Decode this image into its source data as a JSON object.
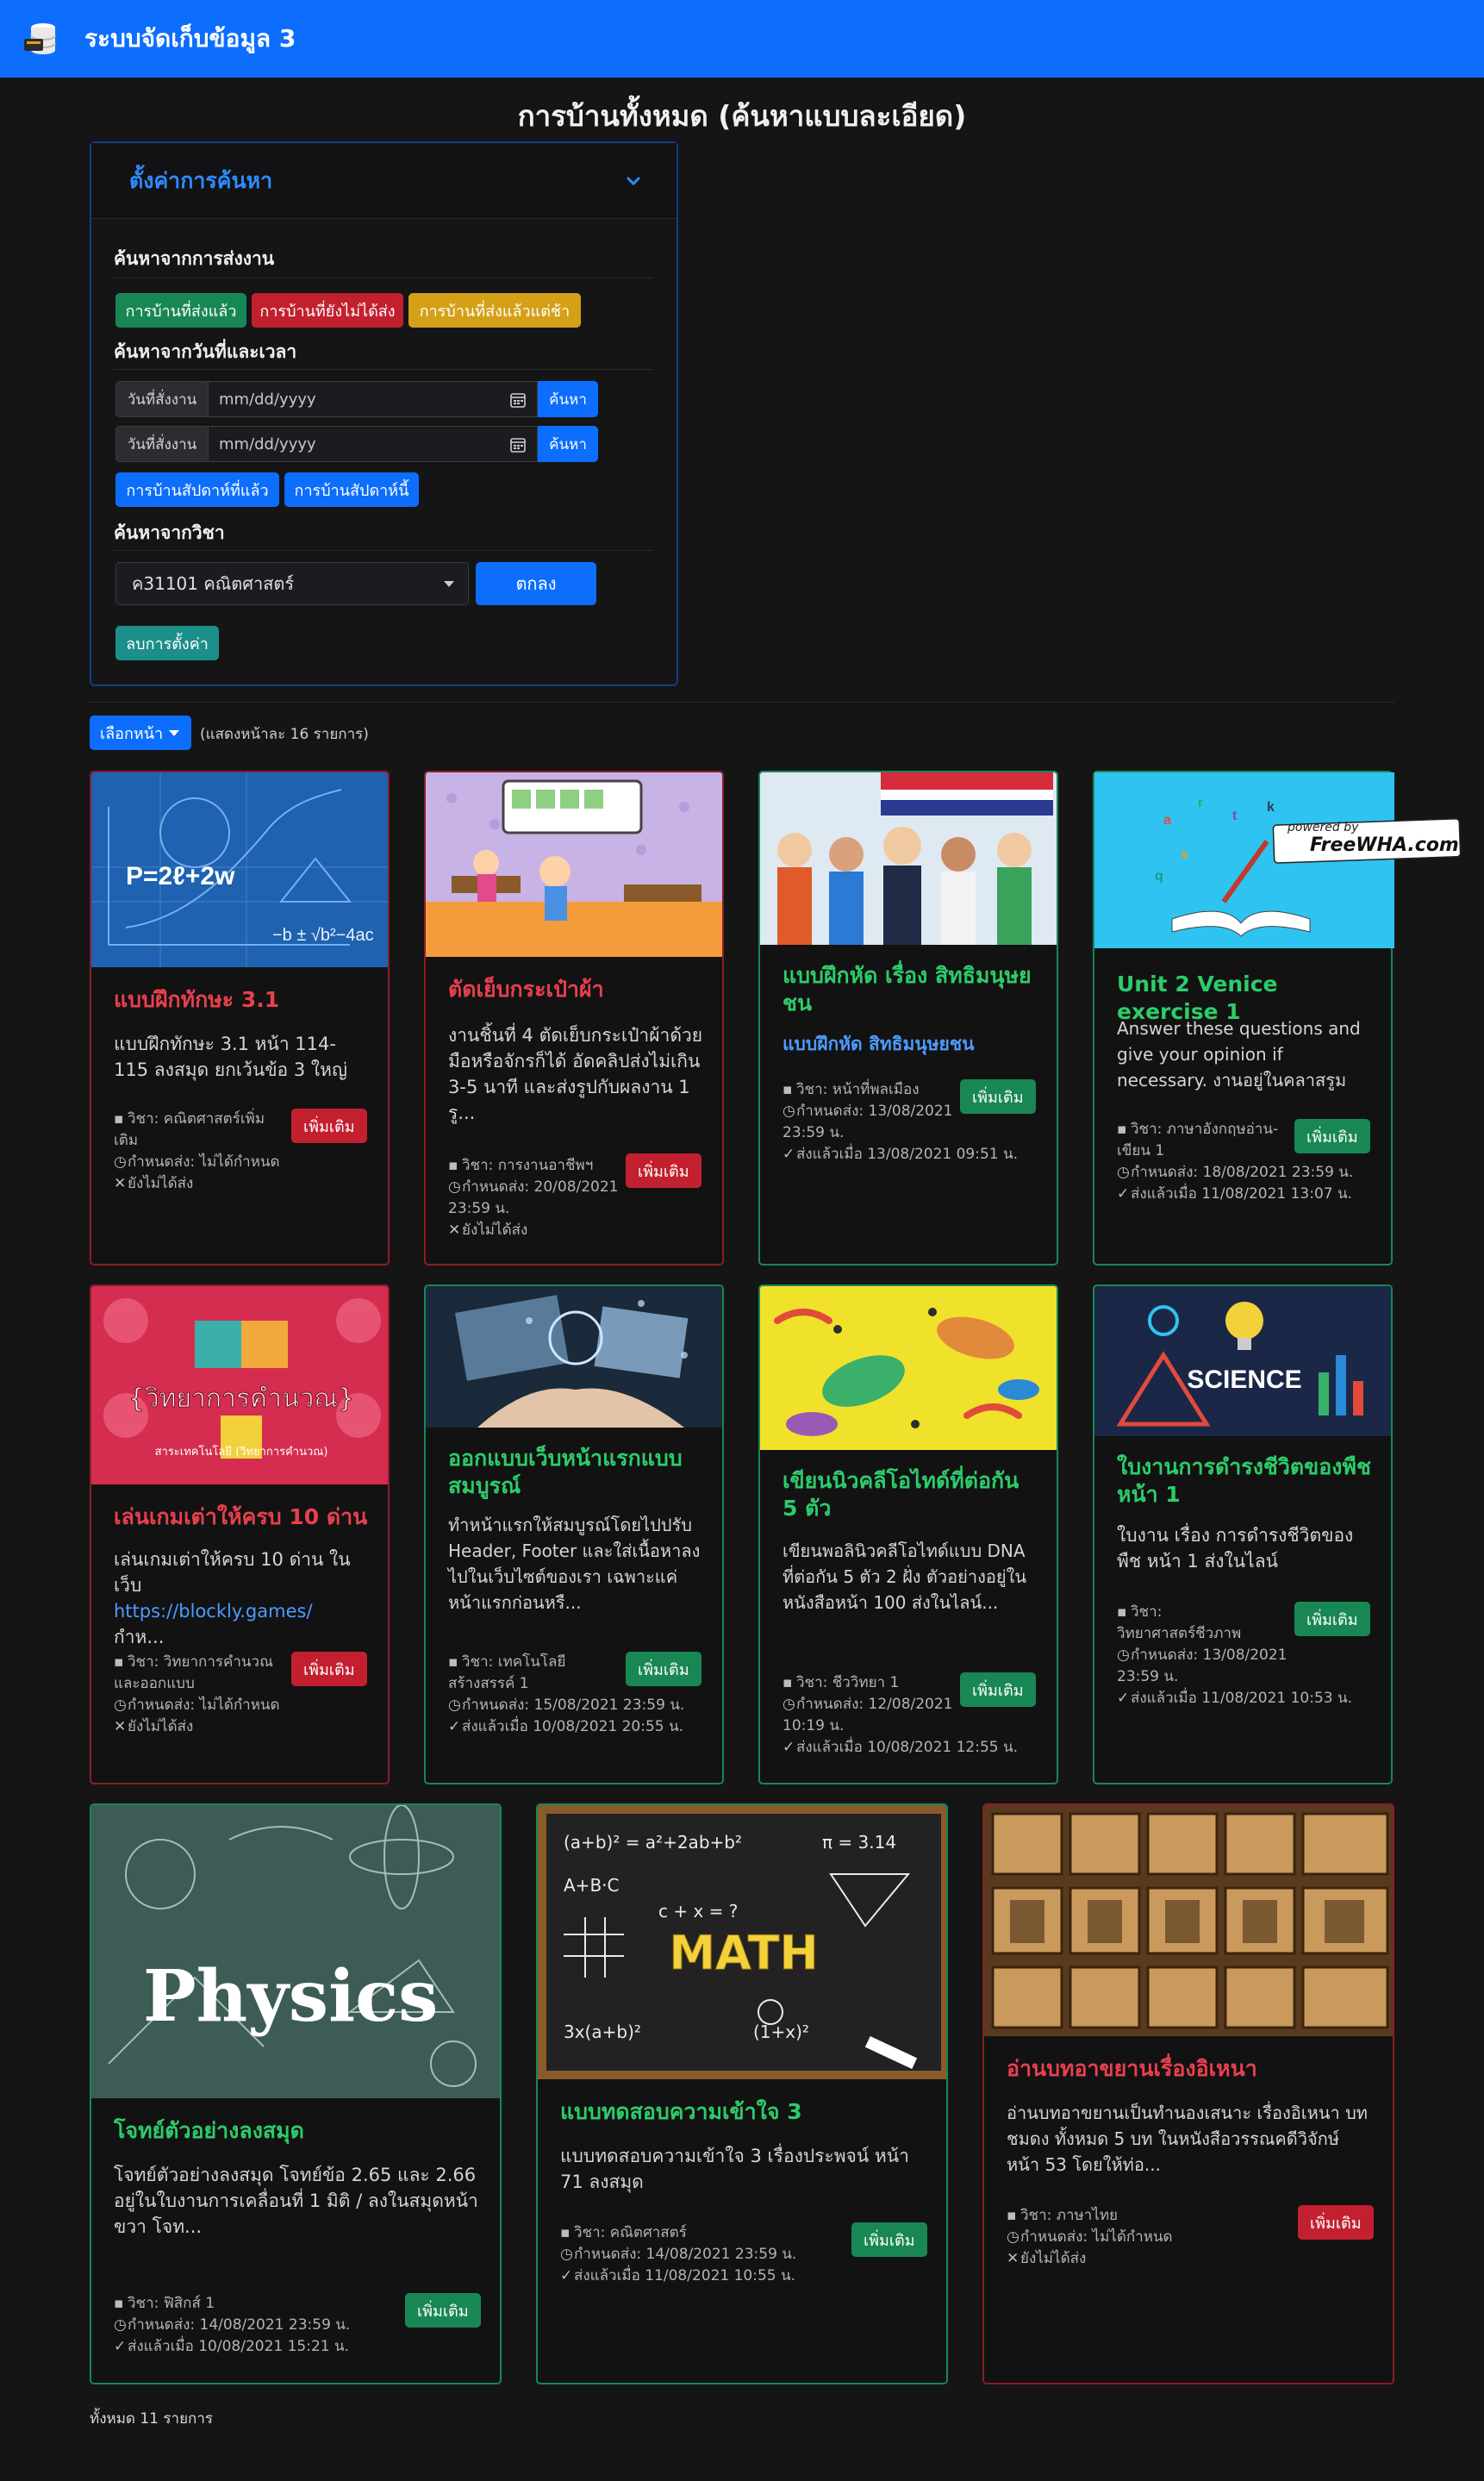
{
  "app": {
    "title": "ระบบจัดเก็บข้อมูล 3"
  },
  "page": {
    "title": "การบ้านทั้งหมด (ค้นหาแบบละเอียด)"
  },
  "search": {
    "header": "ตั้งค่าการค้นหา",
    "by_submission": "ค้นหาจากการส่งงาน",
    "btn_submitted": "การบ้านที่ส่งแล้ว",
    "btn_not_submitted": "การบ้านที่ยังไม่ได้ส่ง",
    "btn_late": "การบ้านที่ส่งแล้วแต่ช้า",
    "by_date": "ค้นหาจากวันที่และเวลา",
    "date_label_1": "วันที่สั่งงาน",
    "date_label_2": "วันที่สั่งงาน",
    "date_placeholder": "mm/dd/yyyy",
    "search_btn": "ค้นหา",
    "btn_last_week": "การบ้านสัปดาห์ที่แล้ว",
    "btn_this_week": "การบ้านสัปดาห์นี้",
    "by_subject": "ค้นหาจากวิชา",
    "subject_selected": "ค31101 คณิตศาสตร์",
    "ok_btn": "ตกลง",
    "clear_btn": "ลบการตั้งค่า"
  },
  "paging": {
    "select_label": "เลือกหน้า",
    "per_page": "(แสดงหน้าละ 16 รายการ)"
  },
  "cards": [
    {
      "title": "แบบฝึกทักษะ 3.1",
      "desc": "แบบฝึกทักษะ 3.1 หน้า 114-115 ลงสมุด ยกเว้นข้อ 3 ใหญ่",
      "subject": "วิชา: คณิตศาสตร์เพิ่มเติม",
      "due": "กำหนดส่ง: ไม่ได้กำหนด",
      "status": "ยังไม่ได้ส่ง",
      "more": "เพิ่มเติม"
    },
    {
      "title": "ตัดเย็บกระเป๋าผ้า",
      "desc": "งานชิ้นที่ 4 ตัดเย็บกระเป๋าผ้าด้วยมือหรือจักรก็ได้ อัดคลิปส่งไม่เกิน 3-5 นาที และส่งรูปกับผลงาน 1 รู...",
      "subject": "วิชา: การงานอาชีพฯ",
      "due": "กำหนดส่ง: 20/08/2021 23:59 น.",
      "status": "ยังไม่ได้ส่ง",
      "more": "เพิ่มเติม"
    },
    {
      "title": "แบบฝึกหัด เรื่อง สิทธิมนุษยชน",
      "desc": "แบบฝึกหัด สิทธิมนุษยชน",
      "subject": "วิชา: หน้าที่พลเมือง",
      "due": "กำหนดส่ง: 13/08/2021 23:59 น.",
      "status": "ส่งแล้วเมื่อ 13/08/2021 09:51 น.",
      "more": "เพิ่มเติม"
    },
    {
      "title": "Unit 2 Venice exercise 1",
      "desc": "Answer these questions and give your opinion if necessary. งานอยู่ในคลาสรูม",
      "subject": "วิชา: ภาษาอังกฤษอ่าน-เขียน 1",
      "due": "กำหนดส่ง: 18/08/2021 23:59 น.",
      "status": "ส่งแล้วเมื่อ 11/08/2021 13:07 น.",
      "more": "เพิ่มเติม",
      "image_text": "FreeWHA.com",
      "image_caption": "powered by"
    },
    {
      "title": "เล่นเกมเต่าให้ครบ 10 ด่าน",
      "desc": "เล่นเกมเต่าให้ครบ 10 ด่าน ในเว็บ",
      "link": "https://blockly.games/",
      "desc2": "กำห...",
      "subject": "วิชา: วิทยาการคำนวณและออกแบบ",
      "due": "กำหนดส่ง: ไม่ได้กำหนด",
      "status": "ยังไม่ได้ส่ง",
      "more": "เพิ่มเติม",
      "image_text": "{วิทยาการคำนวณ}",
      "image_caption": "สาระเทคโนโลยี (วิทยาการคำนวณ)"
    },
    {
      "title": "ออกแบบเว็บหน้าแรกแบบสมบูรณ์",
      "desc": "ทำหน้าแรกให้สมบูรณ์โดยไปปรับ Header, Footer และใส่เนื้อหาลงไปในเว็บไซต์ของเรา เฉพาะแค่หน้าแรกก่อนหรื...",
      "subject": "วิชา: เทคโนโลยีสร้างสรรค์ 1",
      "due": "กำหนดส่ง: 15/08/2021 23:59 น.",
      "status": "ส่งแล้วเมื่อ 10/08/2021 20:55 น.",
      "more": "เพิ่มเติม"
    },
    {
      "title": "เขียนนิวคลีโอไทด์ที่ต่อกัน 5 ตัว",
      "desc": "เขียนพอลินิวคลีโอไทด์แบบ DNA ที่ต่อกัน 5 ตัว 2 ฝั่ง ตัวอย่างอยู่ในหนังสือหน้า 100 ส่งในไลน์...",
      "subject": "วิชา: ชีววิทยา 1",
      "due": "กำหนดส่ง: 12/08/2021 10:19 น.",
      "status": "ส่งแล้วเมื่อ 10/08/2021 12:55 น.",
      "more": "เพิ่มเติม"
    },
    {
      "title": "ใบงานการดำรงชีวิตของพืช หน้า 1",
      "desc": "ใบงาน เรื่อง การดำรงชีวิตของพืช หน้า 1 ส่งในไลน์",
      "subject": "วิชา: วิทยาศาสตร์ชีวภาพ",
      "due": "กำหนดส่ง: 13/08/2021 23:59 น.",
      "status": "ส่งแล้วเมื่อ 11/08/2021 10:53 น.",
      "more": "เพิ่มเติม",
      "image_text": "SCIENCE"
    },
    {
      "title": "โจทย์ตัวอย่างลงสมุด",
      "desc": "โจทย์ตัวอย่างลงสมุด โจทย์ข้อ 2.65 และ 2.66 อยู่ในใบงานการเคลื่อนที่ 1 มิติ / ลงในสมุดหน้าขวา โจท...",
      "subject": "วิชา: ฟิสิกส์ 1",
      "due": "กำหนดส่ง: 14/08/2021 23:59 น.",
      "status": "ส่งแล้วเมื่อ 10/08/2021 15:21 น.",
      "more": "เพิ่มเติม",
      "image_text": "Physics"
    },
    {
      "title": "แบบทดสอบความเข้าใจ 3",
      "desc": "แบบทดสอบความเข้าใจ 3 เรื่องประพจน์ หน้า 71 ลงสมุด",
      "subject": "วิชา: คณิตศาสตร์",
      "due": "กำหนดส่ง: 14/08/2021 23:59 น.",
      "status": "ส่งแล้วเมื่อ 11/08/2021 10:55 น.",
      "more": "เพิ่มเติม",
      "image_text": "MATH"
    },
    {
      "title": "อ่านบทอาขยานเรื่องอิเหนา",
      "desc": "อ่านบทอาขยานเป็นทำนองเสนาะ เรื่องอิเหนา บทชมดง ทั้งหมด 5 บท ในหนังสือวรรณคดีวิจักษ์ หน้า 53 โดยให้ท่อ...",
      "subject": "วิชา: ภาษาไทย",
      "due": "กำหนดส่ง: ไม่ได้กำหนด",
      "status": "ยังไม่ได้ส่ง",
      "more": "เพิ่มเติม"
    }
  ],
  "footer": {
    "total": "ทั้งหมด 11 รายการ"
  }
}
